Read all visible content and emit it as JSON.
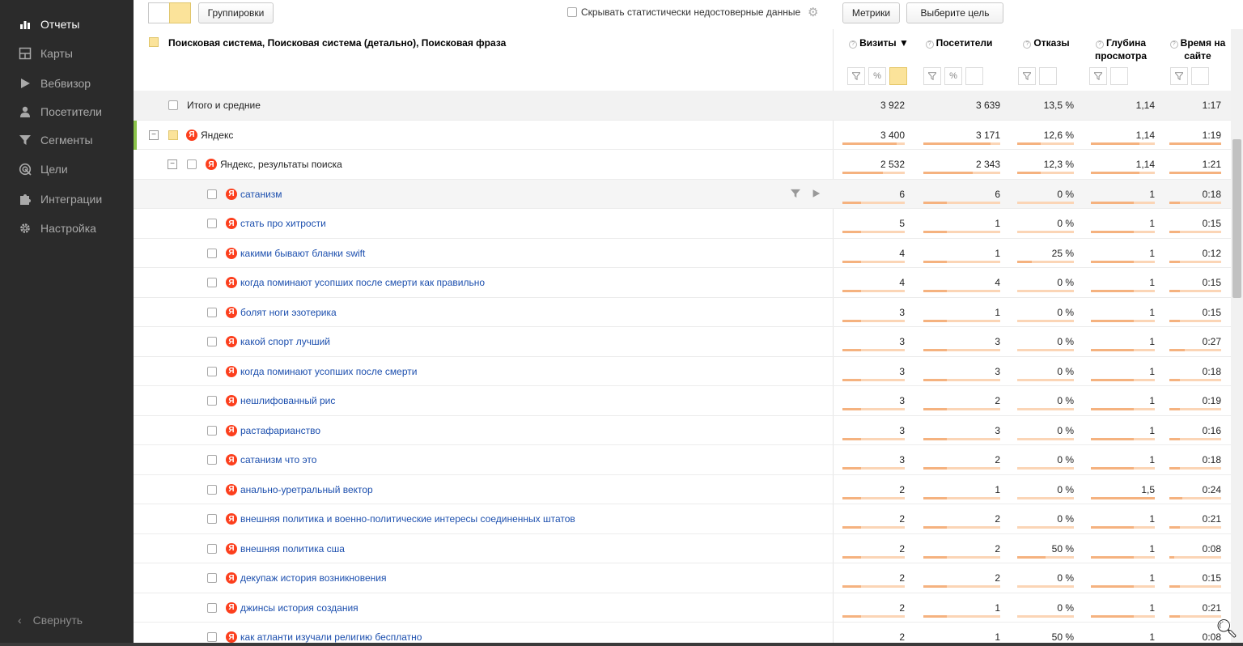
{
  "sidebar": {
    "items": [
      {
        "label": "Отчеты",
        "icon": "bar-chart-icon",
        "active": true
      },
      {
        "label": "Карты",
        "icon": "map-icon",
        "active": false
      },
      {
        "label": "Вебвизор",
        "icon": "play-icon",
        "active": false
      },
      {
        "label": "Посетители",
        "icon": "person-icon",
        "active": false
      },
      {
        "label": "Сегменты",
        "icon": "funnel-icon",
        "active": false
      },
      {
        "label": "Цели",
        "icon": "target-icon",
        "active": false
      },
      {
        "label": "Интеграции",
        "icon": "puzzle-icon",
        "active": false
      },
      {
        "label": "Настройка",
        "icon": "gear-icon",
        "active": false
      }
    ],
    "collapse_label": "Свернуть"
  },
  "toolbar": {
    "groupings_label": "Группировки",
    "hide_unreliable_label": "Скрывать статистически недостоверные данные",
    "metrics_label": "Метрики",
    "select_goal_label": "Выберите цель"
  },
  "table": {
    "dimension_header": "Поисковая система, Поисковая система (детально), Поисковая фраза",
    "columns": [
      {
        "key": "visits",
        "label": "Визиты ▼"
      },
      {
        "key": "visitors",
        "label": "Посетители"
      },
      {
        "key": "bounces",
        "label": "Отказы"
      },
      {
        "key": "depth",
        "label": "Глубина просмотра"
      },
      {
        "key": "time",
        "label": "Время на сайте"
      }
    ],
    "rows": [
      {
        "level": 0,
        "type": "total",
        "label": "Итого и средние",
        "visits": "3 922",
        "visitors": "3 639",
        "bounces": "13,5 %",
        "depth": "1,14",
        "time": "1:17"
      },
      {
        "level": 1,
        "type": "group",
        "label": "Яндекс",
        "visits": "3 400",
        "visitors": "3 171",
        "bounces": "12,6 %",
        "depth": "1,14",
        "time": "1:19",
        "bars": [
          0.87,
          0.87,
          0.42,
          0.76,
          1.0
        ]
      },
      {
        "level": 2,
        "type": "group",
        "label": "Яндекс, результаты поиска",
        "visits": "2 532",
        "visitors": "2 343",
        "bounces": "12,3 %",
        "depth": "1,14",
        "time": "1:21",
        "bars": [
          0.65,
          0.64,
          0.41,
          0.76,
          1.0
        ]
      },
      {
        "level": 3,
        "type": "phrase",
        "label": "сатанизм",
        "visits": "6",
        "visitors": "6",
        "bounces": "0 %",
        "depth": "1",
        "time": "0:18",
        "bars": [
          0.3,
          0.3,
          0.0,
          0.67,
          0.2
        ]
      },
      {
        "level": 3,
        "type": "phrase",
        "label": "стать про хитрости",
        "visits": "5",
        "visitors": "1",
        "bounces": "0 %",
        "depth": "1",
        "time": "0:15",
        "bars": [
          0.3,
          0.3,
          0.0,
          0.67,
          0.2
        ]
      },
      {
        "level": 3,
        "type": "phrase",
        "label": "какими бывают бланки swift",
        "visits": "4",
        "visitors": "1",
        "bounces": "25 %",
        "depth": "1",
        "time": "0:12",
        "bars": [
          0.3,
          0.3,
          0.25,
          0.67,
          0.2
        ]
      },
      {
        "level": 3,
        "type": "phrase",
        "label": "когда поминают усопших после смерти как правильно",
        "visits": "4",
        "visitors": "4",
        "bounces": "0 %",
        "depth": "1",
        "time": "0:15",
        "bars": [
          0.3,
          0.3,
          0.0,
          0.67,
          0.2
        ]
      },
      {
        "level": 3,
        "type": "phrase",
        "label": "болят ноги эзотерика",
        "visits": "3",
        "visitors": "1",
        "bounces": "0 %",
        "depth": "1",
        "time": "0:15",
        "bars": [
          0.3,
          0.3,
          0.0,
          0.67,
          0.2
        ]
      },
      {
        "level": 3,
        "type": "phrase",
        "label": "какой спорт лучший",
        "visits": "3",
        "visitors": "3",
        "bounces": "0 %",
        "depth": "1",
        "time": "0:27",
        "bars": [
          0.3,
          0.3,
          0.0,
          0.67,
          0.3
        ]
      },
      {
        "level": 3,
        "type": "phrase",
        "label": "когда поминают усопших после смерти",
        "visits": "3",
        "visitors": "3",
        "bounces": "0 %",
        "depth": "1",
        "time": "0:18",
        "bars": [
          0.3,
          0.3,
          0.0,
          0.67,
          0.2
        ]
      },
      {
        "level": 3,
        "type": "phrase",
        "label": "нешлифованный рис",
        "visits": "3",
        "visitors": "2",
        "bounces": "0 %",
        "depth": "1",
        "time": "0:19",
        "bars": [
          0.3,
          0.3,
          0.0,
          0.67,
          0.2
        ]
      },
      {
        "level": 3,
        "type": "phrase",
        "label": "растафарианство",
        "visits": "3",
        "visitors": "3",
        "bounces": "0 %",
        "depth": "1",
        "time": "0:16",
        "bars": [
          0.3,
          0.3,
          0.0,
          0.67,
          0.2
        ]
      },
      {
        "level": 3,
        "type": "phrase",
        "label": "сатанизм что это",
        "visits": "3",
        "visitors": "2",
        "bounces": "0 %",
        "depth": "1",
        "time": "0:18",
        "bars": [
          0.3,
          0.3,
          0.0,
          0.67,
          0.2
        ]
      },
      {
        "level": 3,
        "type": "phrase",
        "label": "анально-уретральный вектор",
        "visits": "2",
        "visitors": "1",
        "bounces": "0 %",
        "depth": "1,5",
        "time": "0:24",
        "bars": [
          0.3,
          0.3,
          0.0,
          1.0,
          0.25
        ]
      },
      {
        "level": 3,
        "type": "phrase",
        "label": "внешняя политика и военно-политические интересы соединенных штатов",
        "visits": "2",
        "visitors": "2",
        "bounces": "0 %",
        "depth": "1",
        "time": "0:21",
        "bars": [
          0.3,
          0.3,
          0.0,
          0.67,
          0.2
        ]
      },
      {
        "level": 3,
        "type": "phrase",
        "label": "внешняя политика сша",
        "visits": "2",
        "visitors": "2",
        "bounces": "50 %",
        "depth": "1",
        "time": "0:08",
        "bars": [
          0.3,
          0.3,
          0.5,
          0.67,
          0.1
        ]
      },
      {
        "level": 3,
        "type": "phrase",
        "label": "декупаж история возникновения",
        "visits": "2",
        "visitors": "2",
        "bounces": "0 %",
        "depth": "1",
        "time": "0:15",
        "bars": [
          0.3,
          0.3,
          0.0,
          0.67,
          0.2
        ]
      },
      {
        "level": 3,
        "type": "phrase",
        "label": "джинсы история создания",
        "visits": "2",
        "visitors": "1",
        "bounces": "0 %",
        "depth": "1",
        "time": "0:21",
        "bars": [
          0.3,
          0.3,
          0.0,
          0.67,
          0.2
        ]
      },
      {
        "level": 3,
        "type": "phrase",
        "label": "как атланти изучали религию бесплатно",
        "visits": "2",
        "visitors": "1",
        "bounces": "50 %",
        "depth": "1",
        "time": "0:08",
        "bars": [
          0.3,
          0.3,
          0.5,
          0.67,
          0.1
        ]
      }
    ]
  },
  "colors": {
    "sidebar_bg": "#2b2b2b",
    "link": "#1c4fae",
    "highlight": "#fbe39a",
    "bar": "#f5b27f",
    "group_marker": "#8bc34a",
    "yandex": "#fc3f1d"
  }
}
